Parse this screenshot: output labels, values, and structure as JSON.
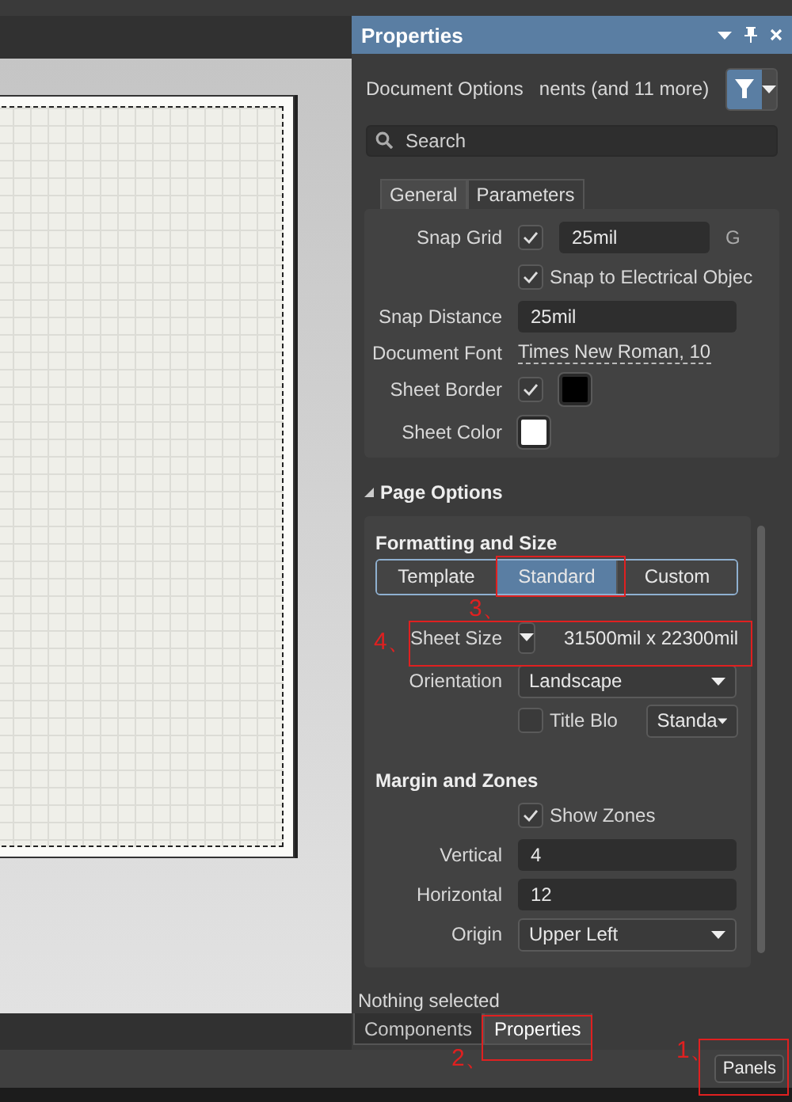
{
  "panel": {
    "title": "Properties"
  },
  "filter": {
    "label": "Document Options",
    "scope": "nents (and 11 more)"
  },
  "search": {
    "placeholder": "Search"
  },
  "tabs": [
    {
      "label": "General",
      "selected": true
    },
    {
      "label": "Parameters",
      "selected": false
    }
  ],
  "general_rows": [
    {
      "kind": "check_field",
      "label": "Snap Grid",
      "checked": true,
      "value": "25mil",
      "suffix": "G"
    },
    {
      "kind": "check_text",
      "checked": true,
      "text": "Snap to Electrical Objec"
    },
    {
      "kind": "field",
      "label": "Snap Distance",
      "value": "25mil"
    },
    {
      "kind": "link",
      "label": "Document Font",
      "text": "Times New Roman, 10"
    },
    {
      "kind": "check_swatch",
      "label": "Sheet Border",
      "checked": true,
      "color": "#000000"
    },
    {
      "kind": "swatch",
      "label": "Sheet Color",
      "color": "#ffffff"
    }
  ],
  "page_options": {
    "title": "Page Options",
    "expanded": true,
    "formatting_title": "Formatting and Size",
    "modes": [
      {
        "label": "Template",
        "selected": false
      },
      {
        "label": "Standard",
        "selected": true
      },
      {
        "label": "Custom",
        "selected": false
      }
    ],
    "rows": [
      {
        "kind": "size",
        "label": "Sheet Size",
        "value": "31500mil  x  22300mil"
      },
      {
        "kind": "dropdown",
        "label": "Orientation",
        "value": "Landscape"
      },
      {
        "kind": "check_dropdown",
        "checked": false,
        "text": "Title Blo",
        "value": "Standa"
      }
    ],
    "margin_title": "Margin and Zones",
    "margin_rows": [
      {
        "kind": "check_text",
        "checked": true,
        "text": "Show Zones"
      },
      {
        "kind": "field",
        "label": "Vertical",
        "value": "4"
      },
      {
        "kind": "field",
        "label": "Horizontal",
        "value": "12"
      },
      {
        "kind": "dropdown",
        "label": "Origin",
        "value": "Upper Left"
      }
    ]
  },
  "status": "Nothing selected",
  "bottom_tabs": [
    {
      "label": "Components",
      "selected": false
    },
    {
      "label": "Properties",
      "selected": true
    }
  ],
  "panels_button": "Panels",
  "annotations": [
    {
      "number": "3、"
    },
    {
      "number": "4、"
    },
    {
      "number": "2、"
    },
    {
      "number": "1、"
    }
  ]
}
